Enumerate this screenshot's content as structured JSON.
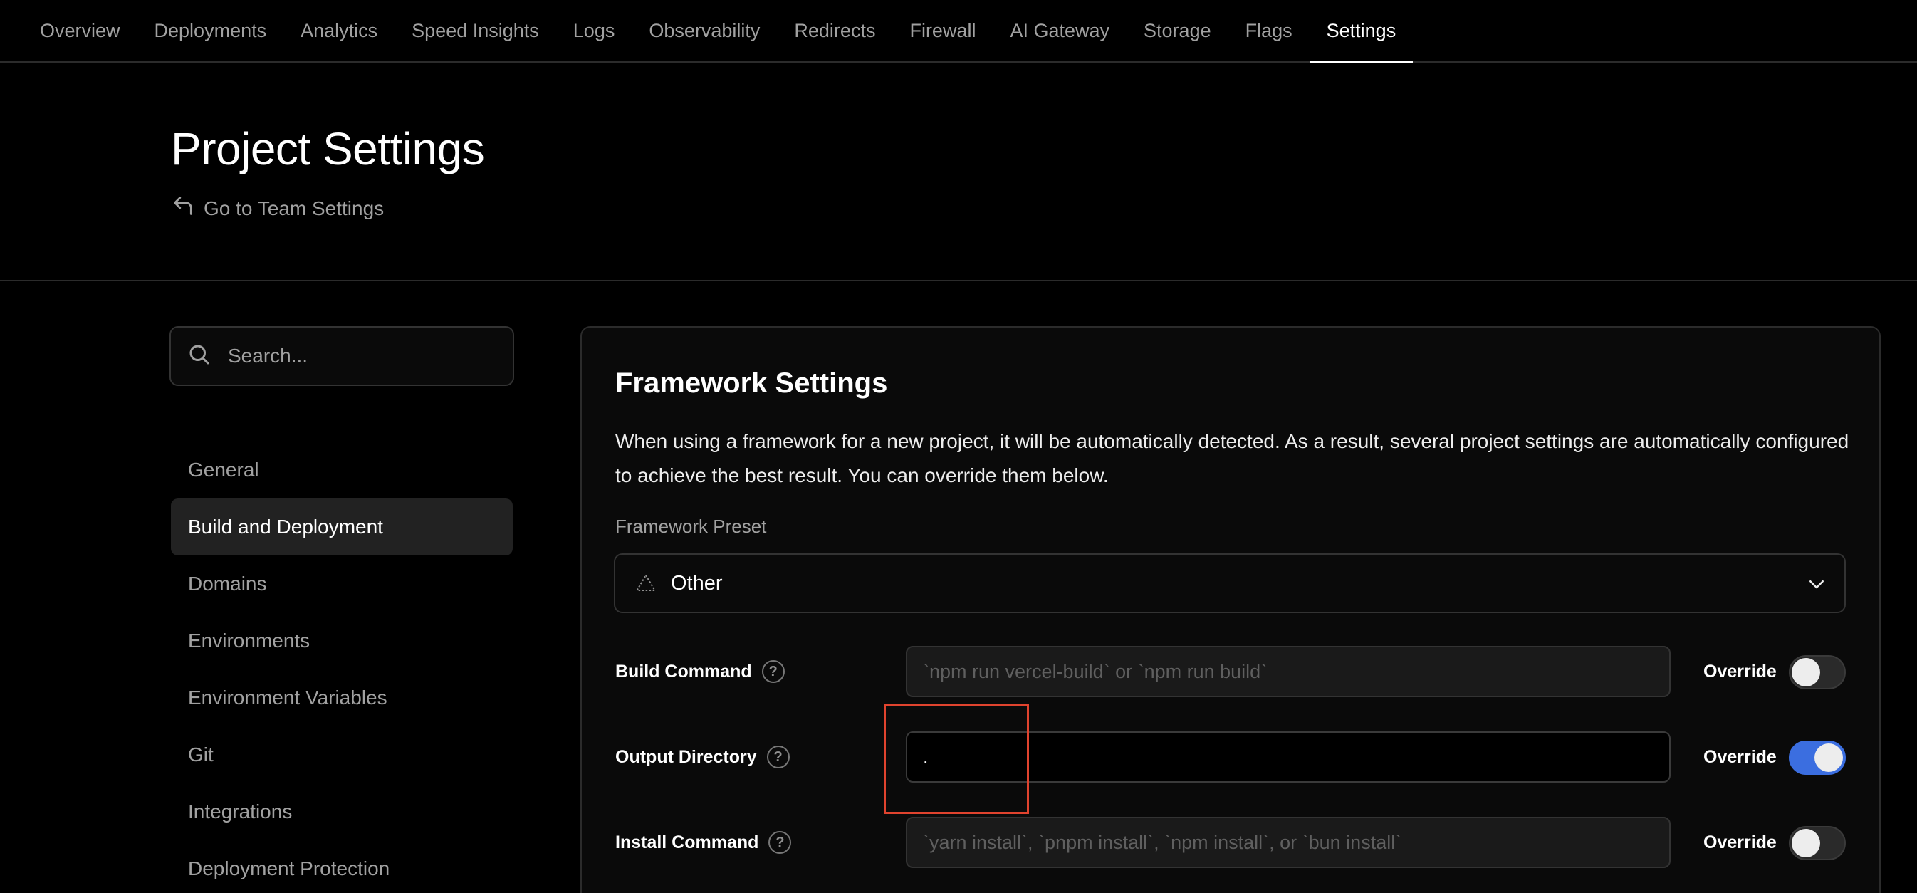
{
  "topnav": {
    "tabs": [
      {
        "label": "Overview"
      },
      {
        "label": "Deployments"
      },
      {
        "label": "Analytics"
      },
      {
        "label": "Speed Insights"
      },
      {
        "label": "Logs"
      },
      {
        "label": "Observability"
      },
      {
        "label": "Redirects"
      },
      {
        "label": "Firewall"
      },
      {
        "label": "AI Gateway"
      },
      {
        "label": "Storage"
      },
      {
        "label": "Flags"
      },
      {
        "label": "Settings"
      }
    ],
    "active": "Settings"
  },
  "header": {
    "title": "Project Settings",
    "back_link": "Go to Team Settings"
  },
  "sidebar": {
    "search_placeholder": "Search...",
    "items": [
      {
        "label": "General"
      },
      {
        "label": "Build and Deployment"
      },
      {
        "label": "Domains"
      },
      {
        "label": "Environments"
      },
      {
        "label": "Environment Variables"
      },
      {
        "label": "Git"
      },
      {
        "label": "Integrations"
      },
      {
        "label": "Deployment Protection"
      }
    ],
    "active": "Build and Deployment"
  },
  "framework": {
    "title": "Framework Settings",
    "description": "When using a framework for a new project, it will be automatically detected. As a result, several project settings are automatically configured to achieve the best result. You can override them below.",
    "preset_label": "Framework Preset",
    "preset_value": "Other",
    "rows": [
      {
        "label": "Build Command",
        "value": "",
        "placeholder": "`npm run vercel-build` or `npm run build`",
        "override_label": "Override",
        "override_on": false
      },
      {
        "label": "Output Directory",
        "value": ".",
        "placeholder": "",
        "override_label": "Override",
        "override_on": true
      },
      {
        "label": "Install Command",
        "value": "",
        "placeholder": "`yarn install`, `pnpm install`, `npm install`, or `bun install`",
        "override_label": "Override",
        "override_on": false
      }
    ]
  },
  "colors": {
    "background": "#000000",
    "toggle_on": "#3b6ee0",
    "highlight": "#e0432e"
  }
}
